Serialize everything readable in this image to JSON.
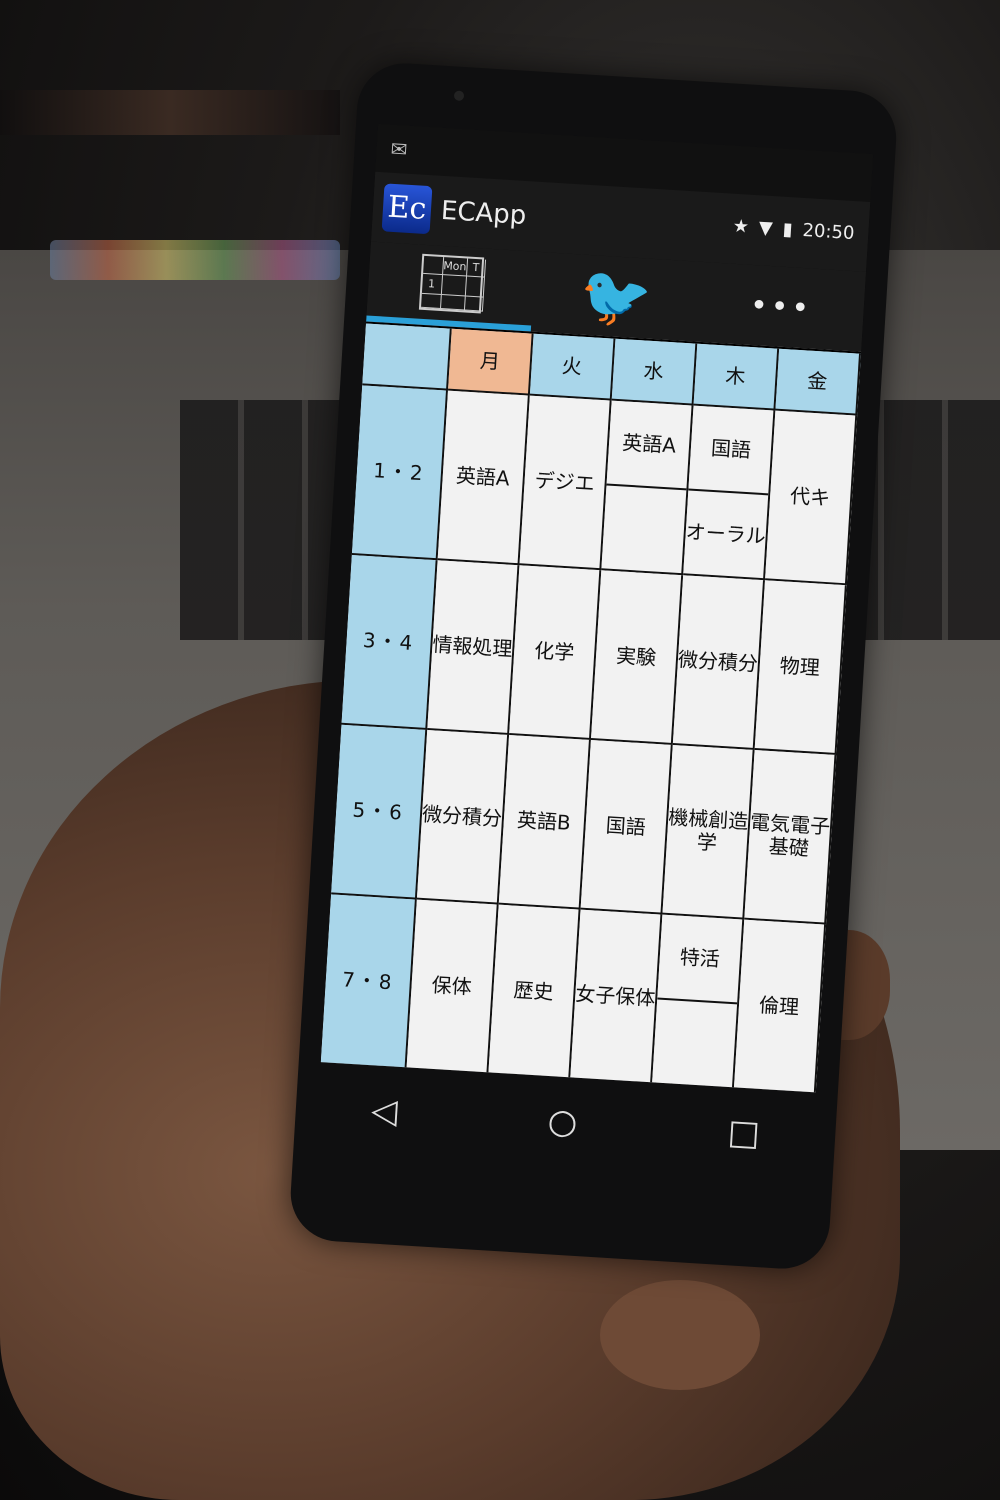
{
  "app": {
    "logo_text": "Ec",
    "title": "ECApp",
    "time": "20:50"
  },
  "tabs": {
    "grid_tab": {
      "mon_label": "Mon",
      "t_label": "T",
      "period_label": "1"
    },
    "more_label": "•••"
  },
  "timetable": {
    "days": [
      "月",
      "火",
      "水",
      "木",
      "金"
    ],
    "today_index": 0,
    "periods": [
      "1・2",
      "3・4",
      "5・6",
      "7・8"
    ],
    "cells": {
      "mon": [
        "英語A",
        "情報処理",
        "微分積分",
        "保体"
      ],
      "tue": [
        "デジエ",
        "化学",
        "英語B",
        "歴史"
      ],
      "wed_p1": "英語A",
      "wed_p2": "実験",
      "wed_p3": "国語",
      "wed_p4": "女子保体",
      "thu_p1a": "国語",
      "thu_p1b": "オーラル",
      "thu_p2": "微分積分",
      "thu_p3": "機械創造学",
      "thu_p4a": "特活",
      "thu_p4b": "",
      "fri": [
        "代キ",
        "物理",
        "電気電子基礎",
        "倫理"
      ]
    }
  },
  "colors": {
    "header_blue": "#a9d6ea",
    "today_orange": "#f0b893",
    "tab_indicator": "#2aa0d8"
  },
  "nav": {
    "back_icon": "◁",
    "home_icon": "○",
    "recent_icon": "□"
  }
}
